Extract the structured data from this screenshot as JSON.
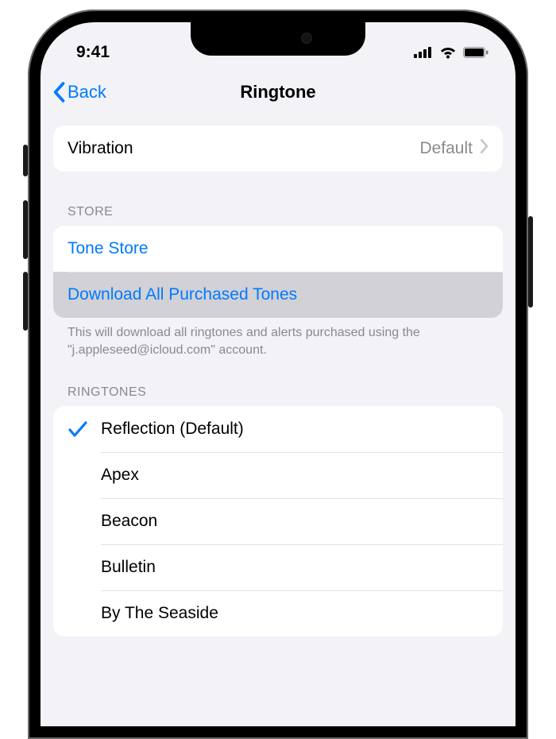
{
  "status": {
    "time": "9:41"
  },
  "nav": {
    "back": "Back",
    "title": "Ringtone"
  },
  "vibration": {
    "label": "Vibration",
    "value": "Default"
  },
  "store": {
    "header": "STORE",
    "tone_store": "Tone Store",
    "download_all": "Download All Purchased Tones",
    "footer": "This will download all ringtones and alerts purchased using the \"j.appleseed@icloud.com\" account."
  },
  "ringtones": {
    "header": "RINGTONES",
    "items": [
      {
        "label": "Reflection (Default)",
        "selected": true
      },
      {
        "label": "Apex",
        "selected": false
      },
      {
        "label": "Beacon",
        "selected": false
      },
      {
        "label": "Bulletin",
        "selected": false
      },
      {
        "label": "By The Seaside",
        "selected": false
      }
    ]
  }
}
